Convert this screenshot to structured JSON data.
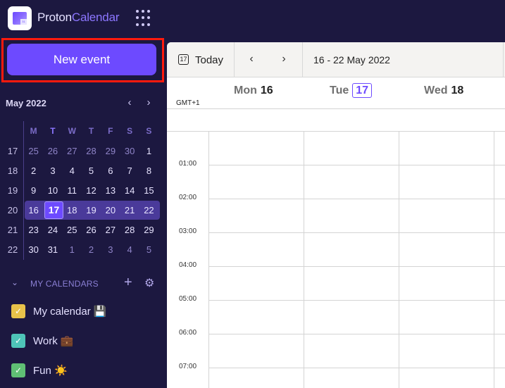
{
  "app": {
    "brand_part1": "Proton",
    "brand_part2": "Calendar",
    "logo_glyph": "31"
  },
  "sidebar": {
    "new_event_label": "New event",
    "mini_calendar": {
      "title": "May 2022",
      "prev_icon": "‹",
      "next_icon": "›",
      "weekdays": [
        "M",
        "T",
        "W",
        "T",
        "F",
        "S",
        "S"
      ],
      "weeks": [
        {
          "week": "17",
          "days": [
            "25",
            "26",
            "27",
            "28",
            "29",
            "30",
            "1"
          ]
        },
        {
          "week": "18",
          "days": [
            "2",
            "3",
            "4",
            "5",
            "6",
            "7",
            "8"
          ]
        },
        {
          "week": "19",
          "days": [
            "9",
            "10",
            "11",
            "12",
            "13",
            "14",
            "15"
          ]
        },
        {
          "week": "20",
          "days": [
            "16",
            "17",
            "18",
            "19",
            "20",
            "21",
            "22"
          ]
        },
        {
          "week": "21",
          "days": [
            "23",
            "24",
            "25",
            "26",
            "27",
            "28",
            "29"
          ]
        },
        {
          "week": "22",
          "days": [
            "30",
            "31",
            "1",
            "2",
            "3",
            "4",
            "5"
          ]
        }
      ],
      "today": "17"
    },
    "my_calendars": {
      "heading": "MY CALENDARS",
      "chevron_icon": "⌄",
      "add_icon": "+",
      "settings_icon": "⚙",
      "items": [
        {
          "label": "My calendar 💾",
          "color": "#e8c24a",
          "checked": true
        },
        {
          "label": "Work 💼",
          "color": "#4ec4b8",
          "checked": true
        },
        {
          "label": "Fun ☀️",
          "color": "#5fbf74",
          "checked": true
        }
      ]
    }
  },
  "toolbar": {
    "today_icon_text": "17",
    "today_label": "Today",
    "prev_icon": "‹",
    "next_icon": "›",
    "range_label": "16 - 22 May 2022"
  },
  "week_view": {
    "timezone": "GMT+1",
    "days": [
      {
        "name": "Mon",
        "num": "16",
        "today": false
      },
      {
        "name": "Tue",
        "num": "17",
        "today": true
      },
      {
        "name": "Wed",
        "num": "18",
        "today": false
      }
    ],
    "hours": [
      "01:00",
      "02:00",
      "03:00",
      "04:00",
      "05:00",
      "06:00",
      "07:00"
    ]
  },
  "colors": {
    "accent": "#6d4aff",
    "sidebar_bg": "#1c1840",
    "highlight": "#ff1a0d"
  }
}
